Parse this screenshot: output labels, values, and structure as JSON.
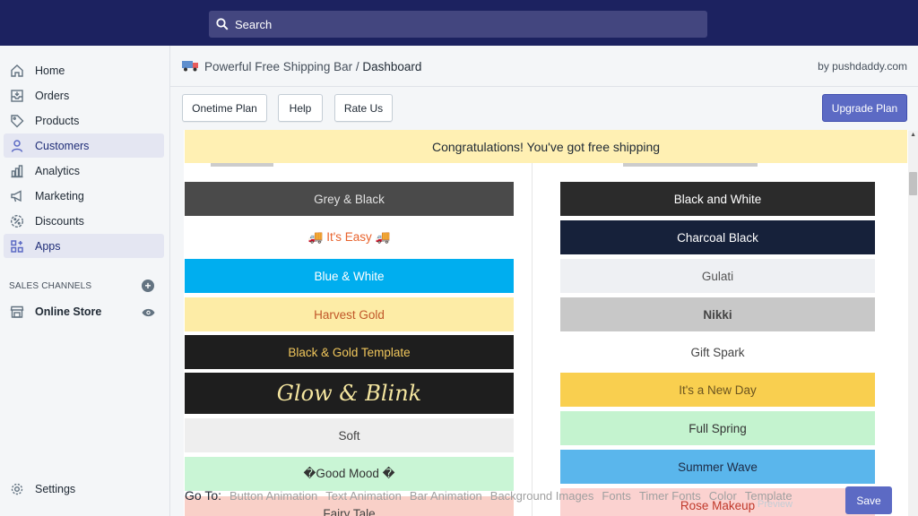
{
  "search": {
    "placeholder": "Search"
  },
  "sidebar": {
    "items": [
      {
        "label": "Home",
        "icon": "home-icon"
      },
      {
        "label": "Orders",
        "icon": "orders-icon"
      },
      {
        "label": "Products",
        "icon": "tag-icon"
      },
      {
        "label": "Customers",
        "icon": "person-icon"
      },
      {
        "label": "Analytics",
        "icon": "bar-chart-icon"
      },
      {
        "label": "Marketing",
        "icon": "megaphone-icon"
      },
      {
        "label": "Discounts",
        "icon": "discount-icon"
      },
      {
        "label": "Apps",
        "icon": "apps-icon"
      }
    ],
    "sales_channels_title": "SALES CHANNELS",
    "online_store": "Online Store",
    "settings": "Settings"
  },
  "header": {
    "app_name": "Powerful Free Shipping Bar",
    "separator": " / ",
    "page": "Dashboard",
    "byline": "by pushdaddy.com"
  },
  "toolbar": {
    "onetime_plan": "Onetime Plan",
    "help": "Help",
    "rate_us": "Rate Us",
    "upgrade_plan": "Upgrade Plan"
  },
  "banner": {
    "text": "Congratulations! You've got free shipping"
  },
  "templates_left": [
    {
      "label": "Grey & Black",
      "bg": "#4a4a4a",
      "fg": "#e0e0e0"
    },
    {
      "label": "🚚 It's Easy 🚚",
      "bg": "#ffffff",
      "fg": "#e8622c"
    },
    {
      "label": "Blue & White",
      "bg": "#00aeef",
      "fg": "#ffffff"
    },
    {
      "label": "Harvest Gold",
      "bg": "#fdeca6",
      "fg": "#c1582a"
    },
    {
      "label": "Black & Gold Template",
      "bg": "#1e1e1e",
      "fg": "#f1c75c"
    },
    {
      "label": "Glow & Blink",
      "bg": "#1e1e1e",
      "fg": "#f5e6a0"
    },
    {
      "label": "Soft",
      "bg": "#eeeeee",
      "fg": "#444444"
    },
    {
      "label": "�Good Mood �",
      "bg": "#c9f5d5",
      "fg": "#333333"
    },
    {
      "label": "Fairy Tale",
      "bg": "#f9d0c8",
      "fg": "#444444"
    }
  ],
  "templates_right": [
    {
      "label": "Black and White",
      "bg": "#2b2b2b",
      "fg": "#ffffff"
    },
    {
      "label": "Charcoal Black",
      "bg": "#16213a",
      "fg": "#ffffff"
    },
    {
      "label": "Gulati",
      "bg": "#eef0f3",
      "fg": "#555555"
    },
    {
      "label": "Nikki",
      "bg": "#c8c8c8",
      "fg": "#444444"
    },
    {
      "label": "Gift Spark",
      "bg": "#ffffff",
      "fg": "#444444"
    },
    {
      "label": "It's a New Day",
      "bg": "#f9cf4f",
      "fg": "#6b5420"
    },
    {
      "label": "Full Spring",
      "bg": "#c4f3cf",
      "fg": "#333333"
    },
    {
      "label": "Summer Wave",
      "bg": "#5ab6ec",
      "fg": "#1e2b45"
    },
    {
      "label": "Rose Makeup",
      "bg": "#fbd2d0",
      "fg": "#c0392b"
    }
  ],
  "footer": {
    "goto_label": "Go To:",
    "links": [
      "Button Animation",
      "Text Animation",
      "Bar Animation",
      "Background Images",
      "Fonts",
      "Timer Fonts",
      "Color",
      "Template"
    ],
    "preview": "Preview",
    "save": "Save"
  },
  "colors": {
    "topbar": "#1c2260",
    "accent": "#5c6ac4",
    "banner": "#fff0b3"
  }
}
